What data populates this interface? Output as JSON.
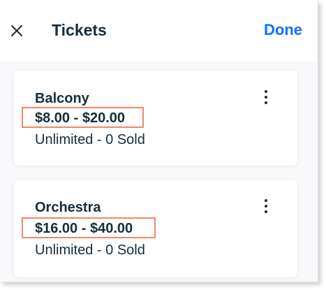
{
  "header": {
    "title": "Tickets",
    "done_label": "Done",
    "close_icon": "close-icon"
  },
  "tickets": [
    {
      "name": "Balcony",
      "price_range": "$8.00 - $20.00",
      "status": "Unlimited - 0 Sold"
    },
    {
      "name": "Orchestra",
      "price_range": "$16.00 - $40.00",
      "status": "Unlimited - 0 Sold"
    }
  ],
  "colors": {
    "accent": "#116dff",
    "text": "#162d3d",
    "highlight_border": "#f0866c"
  }
}
